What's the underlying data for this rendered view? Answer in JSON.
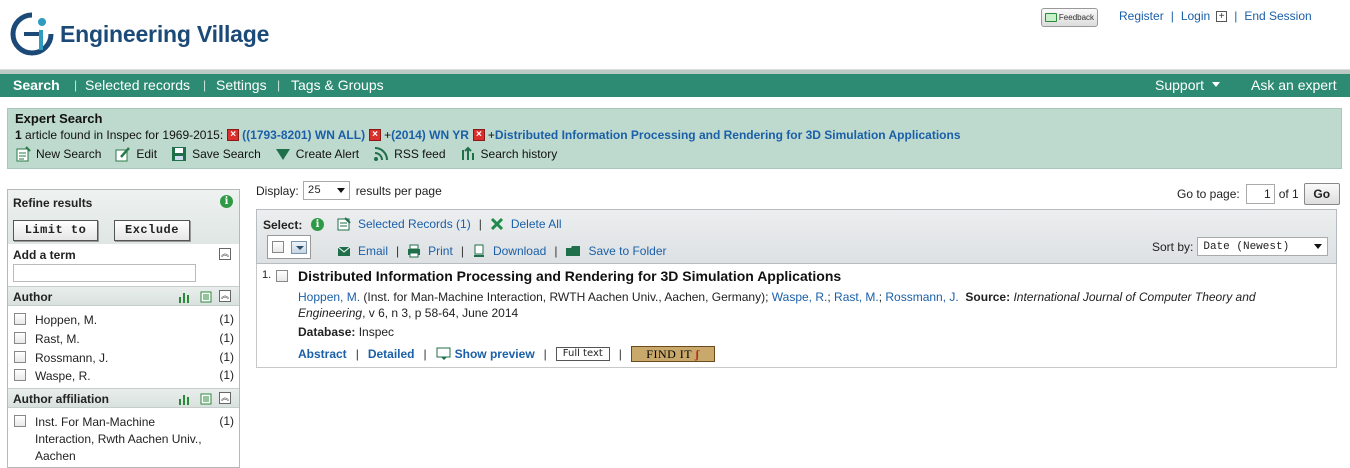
{
  "header": {
    "brand": "Engineering Village",
    "feedback_label": "Feedback",
    "links": {
      "register": "Register",
      "login": "Login",
      "plus": "+",
      "end_session": "End Session"
    }
  },
  "nav": {
    "left": [
      "Search",
      "Selected records",
      "Settings",
      "Tags & Groups"
    ],
    "support": "Support",
    "ask": "Ask an expert"
  },
  "expert": {
    "title": "Expert Search",
    "count": "1",
    "found_text": " article found in Inspec for 1969-2015:",
    "terms": [
      {
        "prefix": "",
        "text": "((1793-8201) WN ALL)"
      },
      {
        "prefix": "+",
        "text": "(2014) WN YR"
      },
      {
        "prefix": "+",
        "text": "Distributed Information Processing and Rendering for 3D Simulation Applications"
      }
    ],
    "tools": [
      "New Search",
      "Edit",
      "Save Search",
      "Create Alert",
      "RSS feed",
      "Search history"
    ]
  },
  "sidebar": {
    "title": "Refine results",
    "limit_to": "Limit to",
    "exclude": "Exclude",
    "add_term": "Add a term",
    "author": {
      "title": "Author",
      "items": [
        {
          "label": "Hoppen, M.",
          "count": "(1)"
        },
        {
          "label": "Rast, M.",
          "count": "(1)"
        },
        {
          "label": "Rossmann, J.",
          "count": "(1)"
        },
        {
          "label": "Waspe, R.",
          "count": "(1)"
        }
      ]
    },
    "affiliation": {
      "title": "Author affiliation",
      "items": [
        {
          "label": "Inst. For Man-Machine Interaction, Rwth Aachen Univ., Aachen",
          "count": "(1)"
        }
      ]
    }
  },
  "main": {
    "display_label": "Display:",
    "per_page_value": "25",
    "per_page_suffix": "results per page",
    "goto_label": "Go to page:",
    "page": "1",
    "of_pages": "of 1",
    "go": "Go",
    "select_label": "Select:",
    "selected_records": "Selected Records (1)",
    "delete_all": "Delete All",
    "email": "Email",
    "print": "Print",
    "download": "Download",
    "save_folder": "Save to Folder",
    "sort_label": "Sort by:",
    "sort_value": "Date (Newest)"
  },
  "result": {
    "num": "1.",
    "title": "Distributed Information Processing and Rendering for 3D Simulation Applications",
    "author1": "Hoppen, M.",
    "affil": " (Inst. for Man-Machine Interaction, RWTH Aachen Univ., Aachen, Germany); ",
    "author2": "Waspe, R.",
    "author3": "Rast, M.",
    "author4": "Rossmann, J.",
    "source_label": "Source:",
    "source_journal": "International Journal of Computer Theory and Engineering",
    "source_rest": ", v 6, n 3, p 58-64, June 2014",
    "db_label": "Database:",
    "db_value": " Inspec",
    "abstract": "Abstract",
    "detailed": "Detailed",
    "show_preview": "Show preview",
    "full_text": "Full text",
    "find_it": "FIND IT"
  },
  "colors": {
    "nav": "#2d8b73",
    "expert_bg": "#bedacf",
    "link": "#1a5fa8",
    "brand": "#1c4a78"
  }
}
